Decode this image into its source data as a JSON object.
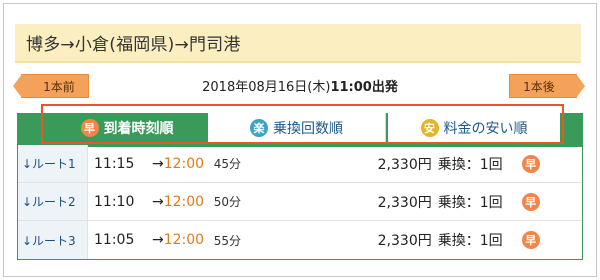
{
  "route": {
    "title": "博多→小倉(福岡県)→門司港"
  },
  "nav": {
    "prev_label": "1本前",
    "next_label": "1本後"
  },
  "departure": {
    "date": "2018年08月16日(木)",
    "time": "11:00出発"
  },
  "tabs": [
    {
      "label": "到着時刻順",
      "icon": "早",
      "icon_color": "#f2854a",
      "active": true
    },
    {
      "label": "乗換回数順",
      "icon": "楽",
      "icon_color": "#3aa4c7",
      "active": false
    },
    {
      "label": "料金の安い順",
      "icon": "安",
      "icon_color": "#e4b32a",
      "active": false
    }
  ],
  "results": [
    {
      "route": "↓ルート1",
      "depart": "11:15",
      "arrow": "→",
      "arrive": "12:00",
      "duration": "45分",
      "price": "2,330円",
      "transfer": "乗換：1回",
      "badge": "早"
    },
    {
      "route": "↓ルート2",
      "depart": "11:10",
      "arrow": "→",
      "arrive": "12:00",
      "duration": "50分",
      "price": "2,330円",
      "transfer": "乗換：1回",
      "badge": "早"
    },
    {
      "route": "↓ルート3",
      "depart": "11:05",
      "arrow": "→",
      "arrive": "12:00",
      "duration": "55分",
      "price": "2,330円",
      "transfer": "乗換：1回",
      "badge": "早"
    }
  ],
  "colors": {
    "accent_green": "#3a9a5a",
    "nav_orange": "#f4a25a",
    "highlight_red": "#e8562a",
    "arrival_orange": "#e07b18",
    "header_bg": "#fbefc2"
  }
}
